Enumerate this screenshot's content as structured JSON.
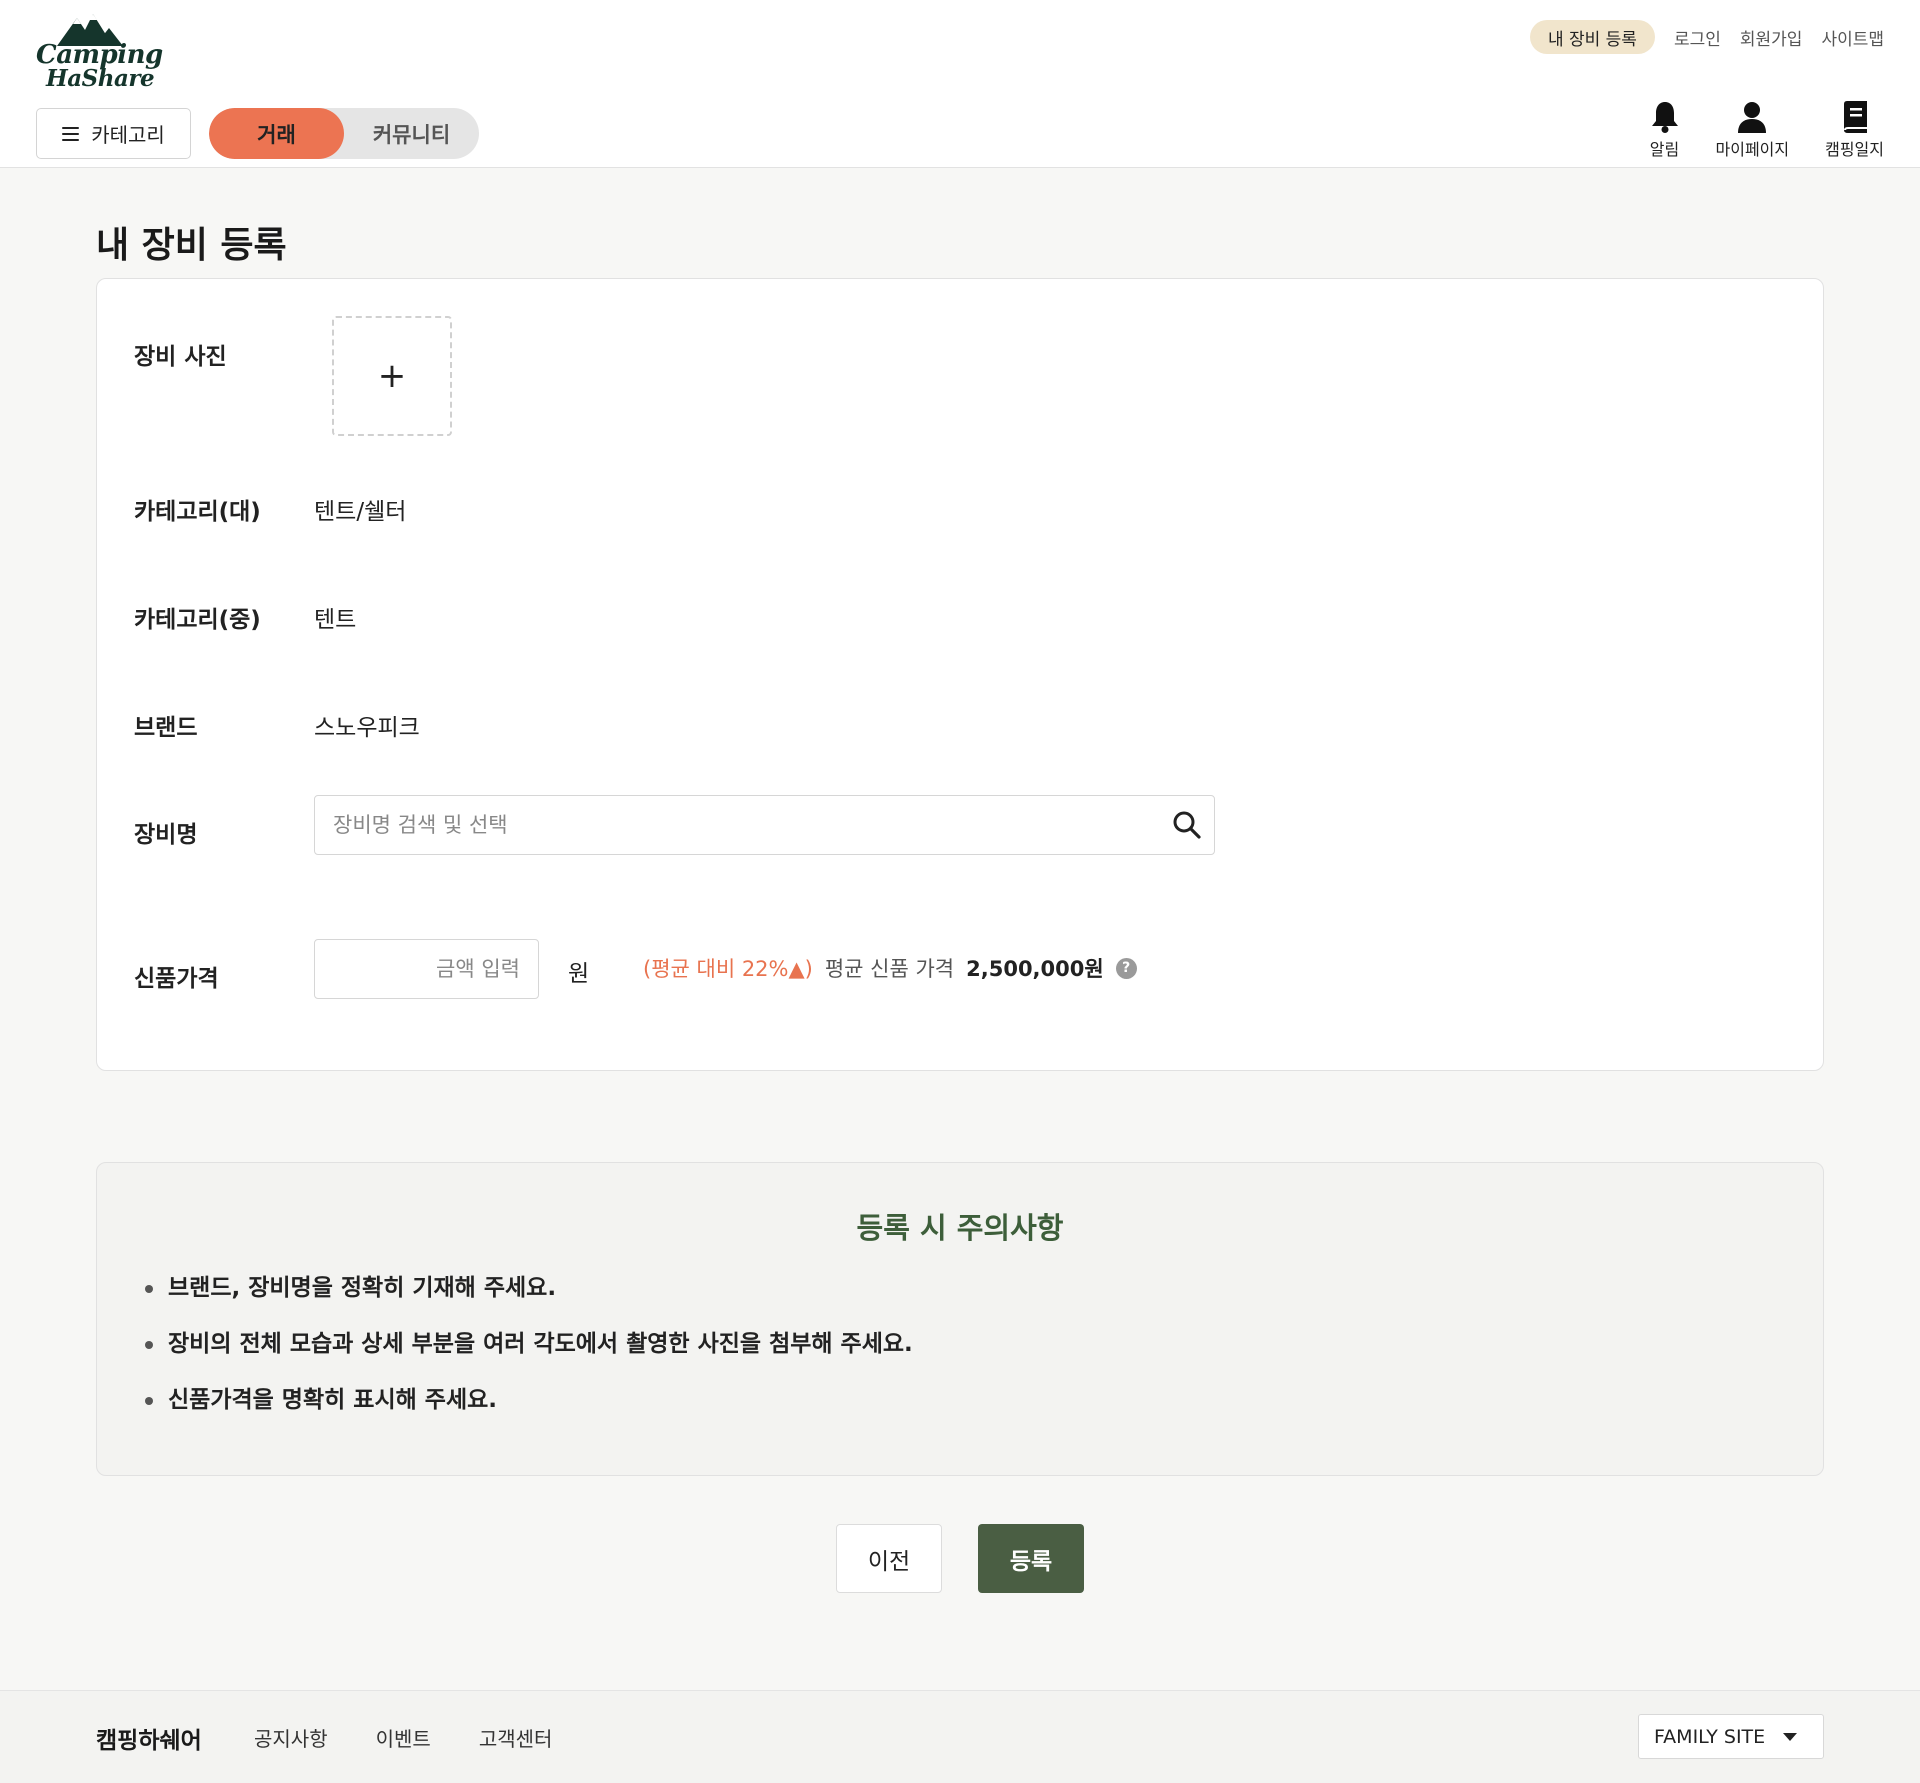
{
  "header": {
    "logo": {
      "line1": "Camping",
      "line2": "HaShare"
    },
    "top_links": {
      "register_gear": "내 장비 등록",
      "login": "로그인",
      "signup": "회원가입",
      "sitemap": "사이트맵"
    },
    "category_button": "카테고리",
    "mode_tabs": {
      "trade": "거래",
      "community": "커뮤니티",
      "active": "거래"
    },
    "icons": {
      "notifications": {
        "label": "알림",
        "icon": "bell-icon"
      },
      "mypage": {
        "label": "마이페이지",
        "icon": "user-icon"
      },
      "journal": {
        "label": "캠핑일지",
        "icon": "book-icon"
      }
    }
  },
  "page": {
    "title": "내 장비 등록"
  },
  "form": {
    "photo": {
      "label": "장비 사진",
      "add_symbol": "+"
    },
    "category_major": {
      "label": "카테고리(대)",
      "value": "텐트/쉘터"
    },
    "category_mid": {
      "label": "카테고리(중)",
      "value": "텐트"
    },
    "brand": {
      "label": "브랜드",
      "value": "스노우피크"
    },
    "gear_name": {
      "label": "장비명",
      "placeholder": "장비명 검색 및 선택",
      "value": ""
    },
    "new_price": {
      "label": "신품가격",
      "placeholder": "금액 입력",
      "value": "",
      "unit": "원",
      "comparison": "(평균 대비 22%▲)",
      "avg_label": "평균 신품 가격",
      "avg_value": "2,500,000원",
      "help_symbol": "?"
    }
  },
  "notice": {
    "title": "등록 시 주의사항",
    "items": [
      "브랜드, 장비명을 정확히 기재해 주세요.",
      "장비의 전체 모습과 상세 부분을 여러 각도에서 촬영한 사진을 첨부해 주세요.",
      "신품가격을 명확히 표시해 주세요."
    ]
  },
  "actions": {
    "prev": "이전",
    "submit": "등록"
  },
  "footer": {
    "brand": "캠핑하쉐어",
    "links": [
      "공지사항",
      "이벤트",
      "고객센터"
    ],
    "family_site": "FAMILY SITE"
  },
  "colors": {
    "accent_orange": "#ec7452",
    "primary_green": "#4a5e43",
    "notice_title_green": "#3d5e3a",
    "highlight_pill": "#f1e5cc",
    "compare_text": "#e8734f"
  }
}
